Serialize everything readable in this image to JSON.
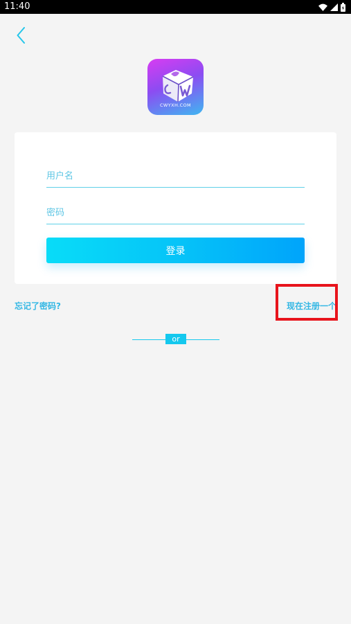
{
  "status_bar": {
    "time": "11:40",
    "icons": [
      "wifi-icon",
      "signal-icon",
      "battery-icon"
    ]
  },
  "nav": {
    "back_icon": "chevron-left-icon"
  },
  "logo": {
    "text": "CWYXH.COM"
  },
  "login_form": {
    "username_placeholder": "用户名",
    "password_placeholder": "密码",
    "login_button": "登录"
  },
  "links": {
    "forgot_password": "忘记了密码?",
    "register": "现在注册一个"
  },
  "divider": {
    "text": "or"
  },
  "colors": {
    "accent": "#14c8ee",
    "link": "#33b7e4",
    "highlight": "#e8141c"
  }
}
